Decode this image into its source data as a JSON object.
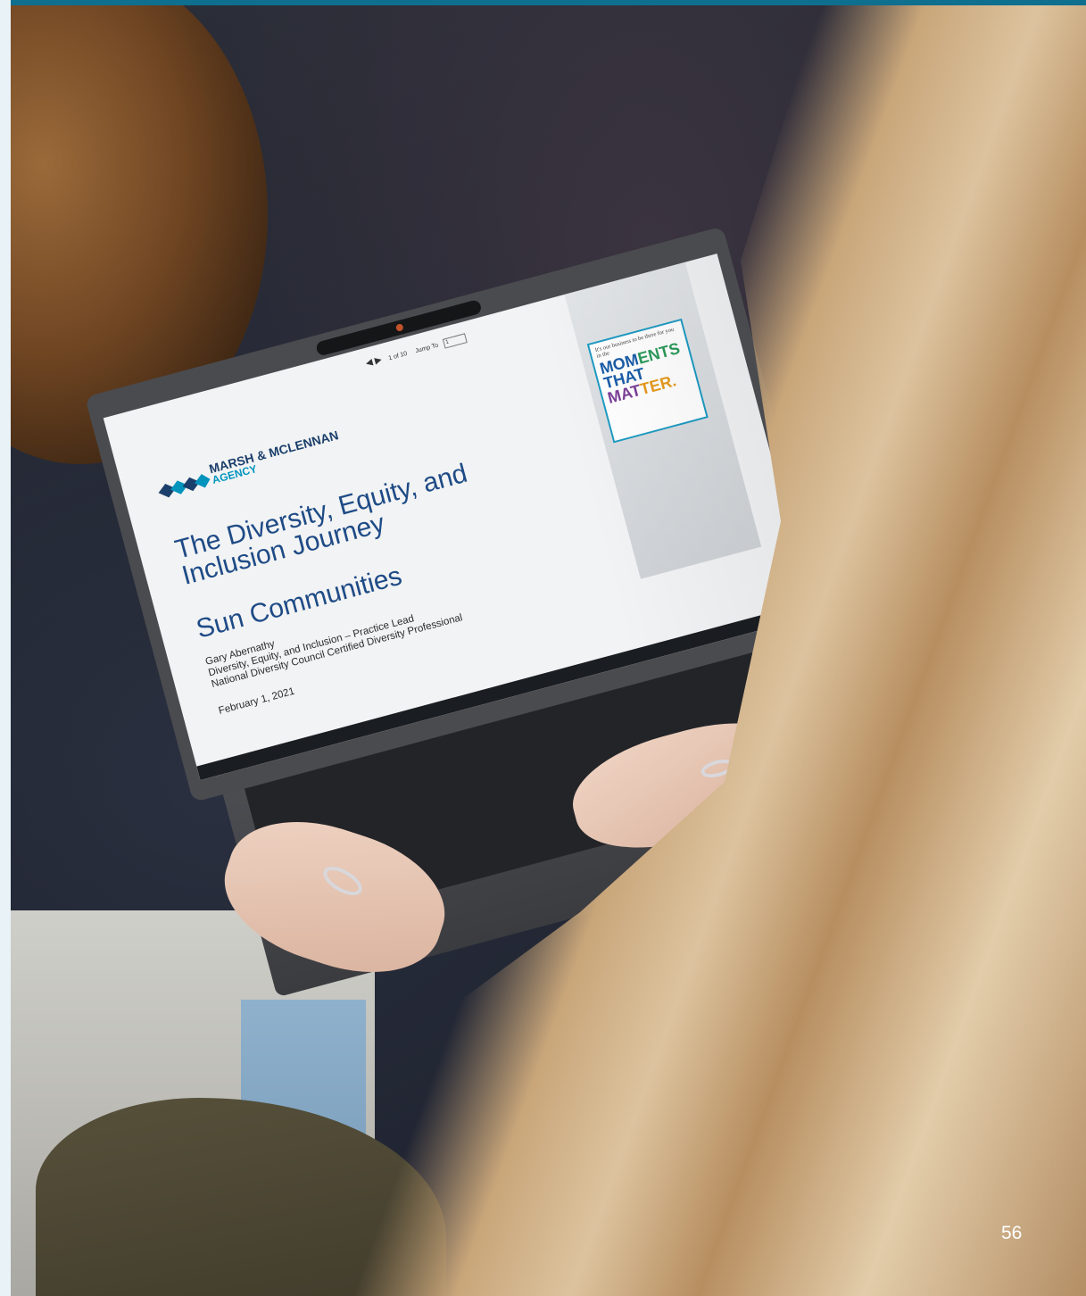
{
  "presentation": {
    "nav": {
      "arrows": "◀ ▶",
      "page_indicator": "1 of 10",
      "jump_label": "Jump To",
      "jump_value": "1"
    },
    "brand": {
      "line1": "MARSH & MCLENNAN",
      "line2": "AGENCY"
    },
    "title": "The Diversity, Equity, and Inclusion Journey",
    "company": "Sun Communities",
    "presenter": "Gary Abernathy",
    "role": "Diversity, Equity, and Inclusion – Practice Lead",
    "credential": "National Diversity Council Certified Diversity Professional",
    "date": "February 1, 2021",
    "moments_small": "It's our business to be there for you in the",
    "moments_line1_a": "MOM",
    "moments_line1_b": "ENTS",
    "moments_line2": "THAT",
    "moments_line3_a": "MAT",
    "moments_line3_b": "TER."
  },
  "page_number": "56",
  "colors": {
    "top_bar": "#0f6f8e",
    "left_bar": "#e9f2f7",
    "title_blue": "#1e4b86",
    "agency_cyan": "#0094bd"
  }
}
